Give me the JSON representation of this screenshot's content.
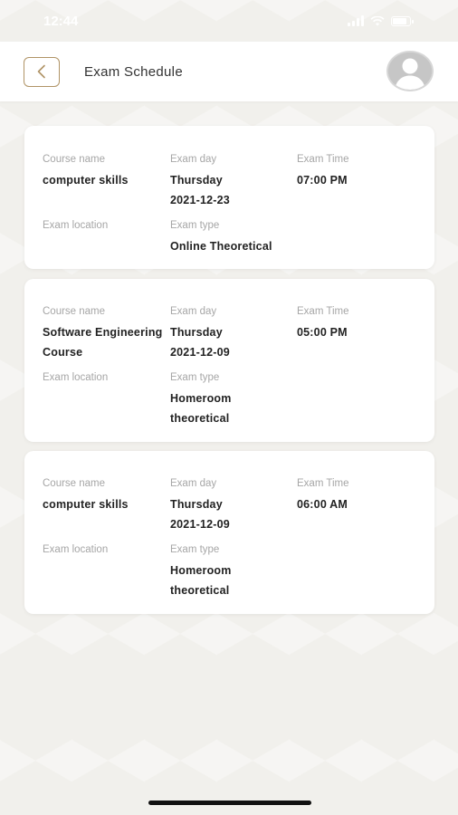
{
  "status_bar": {
    "time": "12:44"
  },
  "header": {
    "title": "Exam Schedule"
  },
  "labels": {
    "course_name": "Course name",
    "exam_day": "Exam day",
    "exam_time": "Exam Time",
    "exam_location": "Exam location",
    "exam_type": "Exam type"
  },
  "exams": [
    {
      "course_name": "computer skills",
      "day_name": "Thursday",
      "date": "2021-12-23",
      "time": "07:00 PM",
      "location": "",
      "type": "Online Theoretical"
    },
    {
      "course_name": "Software Engineering Course",
      "day_name": "Thursday",
      "date": "2021-12-09",
      "time": "05:00 PM",
      "location": "",
      "type": "Homeroom theoretical"
    },
    {
      "course_name": "computer skills",
      "day_name": "Thursday",
      "date": "2021-12-09",
      "time": "06:00 AM",
      "location": "",
      "type": "Homeroom theoretical"
    }
  ],
  "colors": {
    "accent": "#b09466",
    "background": "#f1f0ec",
    "card": "#ffffff",
    "label": "#a6a6a6"
  }
}
